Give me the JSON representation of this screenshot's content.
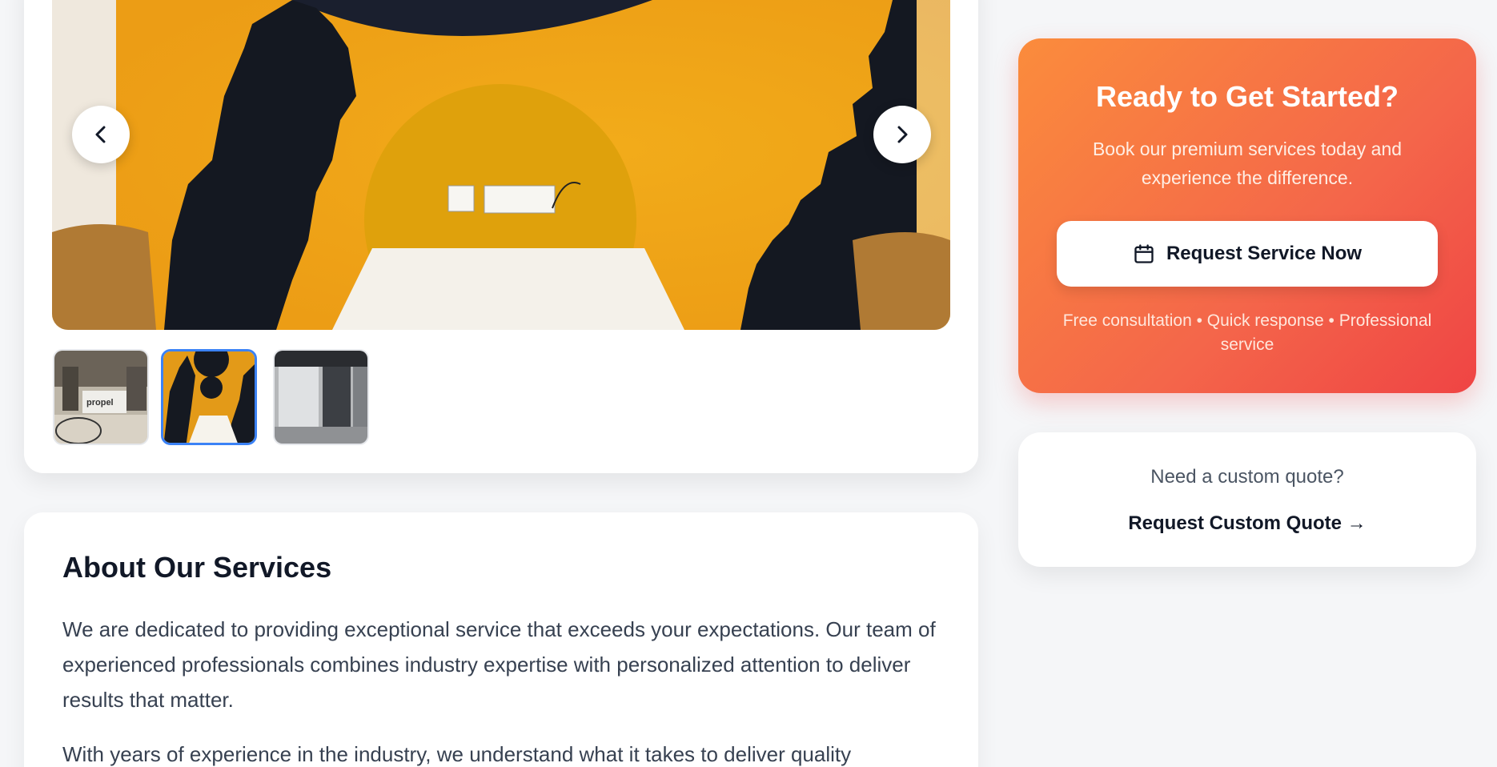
{
  "gallery": {
    "prev_icon": "chevron-left-icon",
    "next_icon": "chevron-right-icon",
    "thumbnails": [
      {
        "name": "reception-thumbnail",
        "logo_text": "propel",
        "active": false
      },
      {
        "name": "mural-room-thumbnail",
        "active": true
      },
      {
        "name": "corridor-thumbnail",
        "active": false
      }
    ],
    "colors": {
      "mural": "#f0a21a",
      "silhouette": "#111827",
      "active_border": "#3b82f6"
    }
  },
  "about": {
    "title": "About Our Services",
    "paragraph1": "We are dedicated to providing exceptional service that exceeds your expectations. Our team of experienced professionals combines industry expertise with personalized attention to deliver results that matter.",
    "paragraph2": "With years of experience in the industry, we understand what it takes to deliver quality"
  },
  "cta": {
    "title": "Ready to Get Started?",
    "subtitle": "Book our premium services today and experience the difference.",
    "button_label": "Request Service Now",
    "button_icon": "calendar-icon",
    "footnote": "Free consultation • Quick response • Professional service",
    "colors": {
      "gradient_start": "#fb8c3c",
      "gradient_end": "#ef4444"
    }
  },
  "quote": {
    "question": "Need a custom quote?",
    "link_label": "Request Custom Quote →"
  }
}
